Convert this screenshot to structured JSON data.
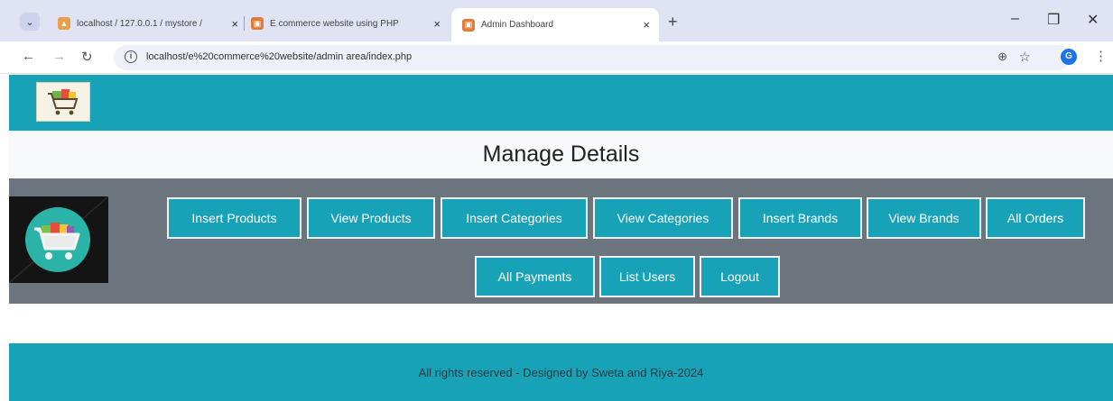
{
  "browser": {
    "tabs": [
      {
        "title": "localhost / 127.0.0.1 / mystore /",
        "close": "×"
      },
      {
        "title": "E commerce website using PHP",
        "close": "×"
      },
      {
        "title": "Admin Dashboard",
        "close": "×"
      }
    ],
    "new_tab": "+",
    "url": "localhost/e%20commerce%20website/admin area/index.php",
    "profile_initial": "G"
  },
  "page": {
    "title": "Manage Details",
    "buttons": {
      "insert_products": "Insert Products",
      "view_products": "View Products",
      "insert_categories": "Insert Categories",
      "view_categories": "View Categories",
      "insert_brands": "Insert Brands",
      "view_brands": "View Brands",
      "all_orders": "All Orders",
      "all_payments": "All Payments",
      "list_users": "List Users",
      "logout": "Logout"
    },
    "footer": "All rights reserved - Designed by Sweta and Riya-2024"
  },
  "colors": {
    "accent": "#17a2b8",
    "panel": "#6c757d",
    "title_bg": "#f8f9fa"
  }
}
